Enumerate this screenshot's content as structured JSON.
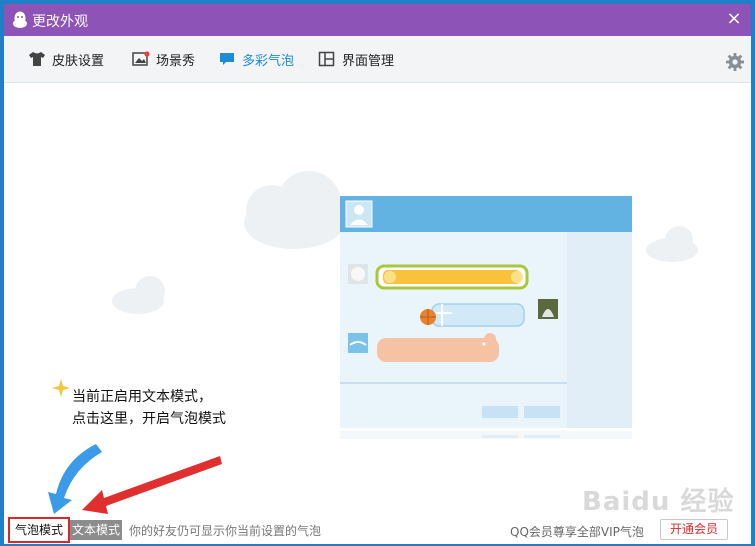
{
  "window": {
    "title": "更改外观",
    "close_label": "×"
  },
  "tabs": [
    {
      "label": "皮肤设置",
      "icon": "shirt-icon"
    },
    {
      "label": "场景秀",
      "icon": "picture-icon"
    },
    {
      "label": "多彩气泡",
      "icon": "chat-bubble-icon",
      "active": true
    },
    {
      "label": "界面管理",
      "icon": "layout-icon"
    }
  ],
  "hint": {
    "line1": "当前正启用文本模式，",
    "line2": "点击这里，开启气泡模式"
  },
  "bottom": {
    "bubble_mode": "气泡模式",
    "text_mode": "文本模式",
    "description": "你的好友仍可显示你当前设置的气泡",
    "vip_text": "QQ会员尊享全部VIP气泡",
    "vip_button": "开通会员"
  },
  "watermark": "Baidu 经验",
  "colors": {
    "title_bar": "#8e53b7",
    "active_tab": "#1e8bd6",
    "highlight_border": "#d9282d"
  }
}
